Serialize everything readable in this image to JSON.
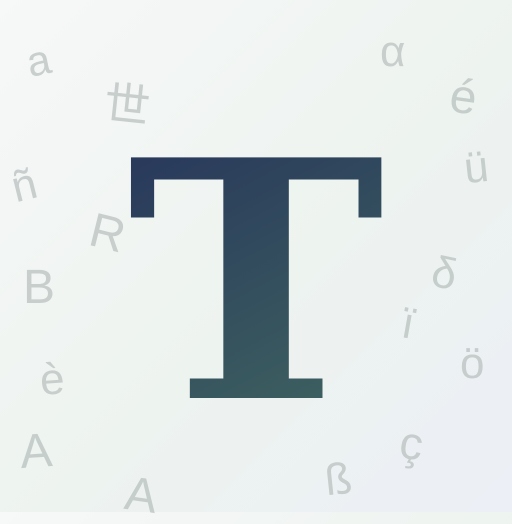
{
  "logo": {
    "letter": "T",
    "gradient_top": "#25315a",
    "gradient_bottom": "#3d6160"
  },
  "background_glyphs": [
    "a",
    "世",
    "ñ",
    "R",
    "B",
    "è",
    "A",
    "A",
    "α",
    "é",
    "ü",
    "δ",
    "ï",
    "ö",
    "ç",
    "ß"
  ],
  "colors": {
    "glyph": "#bcc4c2",
    "background_start": "#f7f8f8",
    "background_end": "#eceff6"
  }
}
